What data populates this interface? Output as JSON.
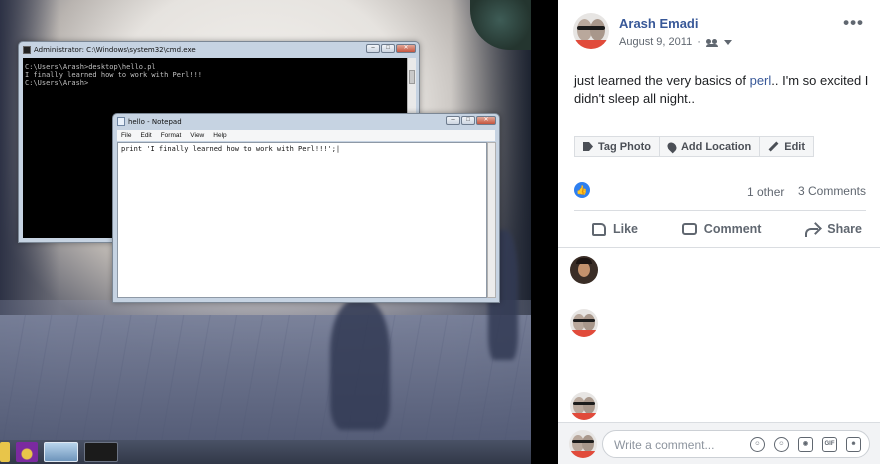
{
  "photo": {
    "cmd": {
      "title": "Administrator: C:\\Windows\\system32\\cmd.exe",
      "lines": "C:\\Users\\Arash>desktop\\hello.pl\nI finally learned how to work with Perl!!!\nC:\\Users\\Arash>"
    },
    "notepad": {
      "title": "hello - Notepad",
      "menu": [
        "File",
        "Edit",
        "Format",
        "View",
        "Help"
      ],
      "content": "print 'I finally learned how to work with Perl!!!';|"
    }
  },
  "post": {
    "author": "Arash Emadi",
    "date": "August 9, 2011",
    "audience_icon": "friends-icon",
    "more_label": "•••",
    "text_before": "just learned the very basics of ",
    "link_text": "perl",
    "text_after": ".. I'm so excited I didn't sleep all night..",
    "photo_actions": {
      "tag": "Tag Photo",
      "location": "Add Location",
      "edit": "Edit"
    },
    "reactions": {
      "others": "1 other",
      "comments": "3 Comments"
    },
    "actions": {
      "like": "Like",
      "comment": "Comment",
      "share": "Share"
    },
    "composer": {
      "placeholder": "Write a comment...",
      "gif_label": "GIF"
    }
  },
  "colors": {
    "link_blue": "#385898",
    "like_blue": "#2e7ff0",
    "muted": "#606770"
  }
}
